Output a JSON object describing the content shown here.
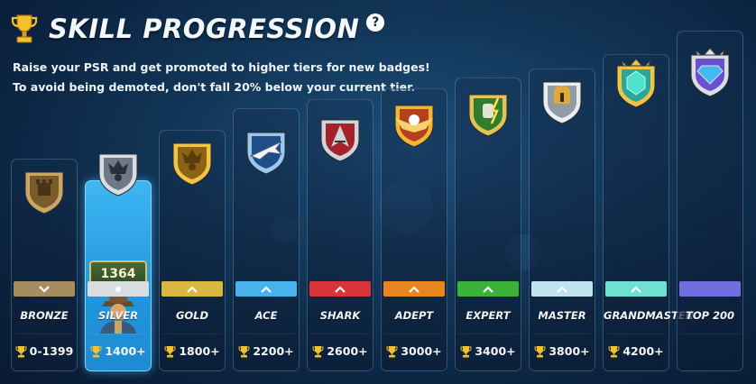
{
  "header": {
    "title": "SKILL PROGRESSION",
    "help_label": "?",
    "line1": "Raise your PSR and get promoted to higher tiers for new badges!",
    "line2": "To avoid being demoted, don't fall 20% below your current tier."
  },
  "current_psr": "1364",
  "colors": {
    "trophy": "#e8b52a",
    "current_panel": "#2a9fe2"
  },
  "tiers": [
    {
      "name": "BRONZE",
      "range": "0-1399",
      "bar_color": "#a58d5f",
      "arrow": "down",
      "badge": "bronze-castle-shield"
    },
    {
      "name": "SILVER",
      "range": "1400+",
      "bar_color": "#d9dde2",
      "arrow": "dot",
      "badge": "silver-crown-shield"
    },
    {
      "name": "GOLD",
      "range": "1800+",
      "bar_color": "#d9b740",
      "arrow": "up",
      "badge": "gold-crown-shield"
    },
    {
      "name": "ACE",
      "range": "2200+",
      "bar_color": "#47b3ea",
      "arrow": "up",
      "badge": "ace-jet-shield"
    },
    {
      "name": "SHARK",
      "range": "2600+",
      "bar_color": "#d8343a",
      "arrow": "up",
      "badge": "shark-shield"
    },
    {
      "name": "ADEPT",
      "range": "3000+",
      "bar_color": "#e7861f",
      "arrow": "up",
      "badge": "eagle-shield"
    },
    {
      "name": "EXPERT",
      "range": "3400+",
      "bar_color": "#3bb33a",
      "arrow": "up",
      "badge": "fist-lightning-shield"
    },
    {
      "name": "MASTER",
      "range": "3800+",
      "bar_color": "#bfe3ef",
      "arrow": "up",
      "badge": "spartan-helmet-shield"
    },
    {
      "name": "GRANDMASTER",
      "range": "4200+",
      "bar_color": "#6fe0d2",
      "arrow": "up",
      "badge": "emerald-crown-shield"
    },
    {
      "name": "TOP 200",
      "range": "",
      "bar_color": "#6f6fe0",
      "arrow": "none",
      "badge": "diamond-crown-shield"
    }
  ]
}
